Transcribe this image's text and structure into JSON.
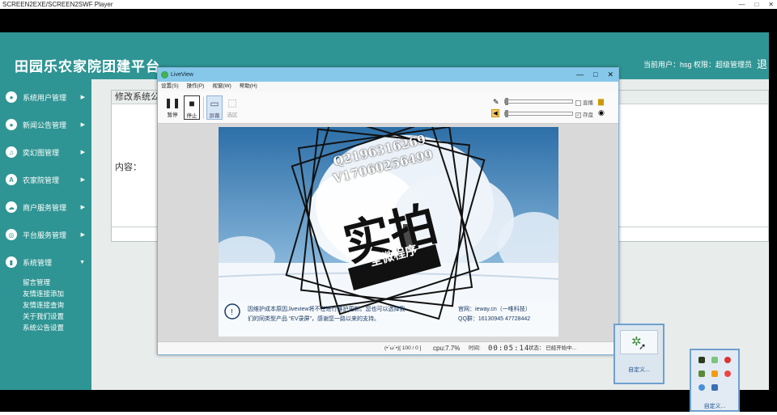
{
  "player": {
    "title": "SCREEN2EXE/SCREEN2SWF Player",
    "controls": [
      "—",
      "□",
      "✕"
    ]
  },
  "app": {
    "title": "田园乐农家院团建平台",
    "user_info": "当前用户：hsg  权限：超级管理员",
    "logout": "退",
    "accent_color": "#2f9594"
  },
  "sidebar": {
    "items": [
      {
        "label": "系统用户管理",
        "icon": "user-icon"
      },
      {
        "label": "新闻公告管理",
        "icon": "people-icon"
      },
      {
        "label": "奕幻图管理",
        "icon": "music-icon"
      },
      {
        "label": "农家院管理",
        "icon": "app-icon"
      },
      {
        "label": "商户服务管理",
        "icon": "cloud-icon"
      },
      {
        "label": "平台服务管理",
        "icon": "target-icon"
      },
      {
        "label": "系统管理",
        "icon": "chart-icon"
      }
    ],
    "sub_items": [
      "留言管理",
      "友情连接添加",
      "友情连接查询",
      "关于我们设置",
      "系统公告设置"
    ]
  },
  "content": {
    "panel_title": "修改系统公",
    "field_label": "内容："
  },
  "liveview": {
    "title": "LiveView",
    "menu": [
      "设置(S)",
      "操作(P)",
      "视窗(W)",
      "帮助(H)"
    ],
    "toolbar": {
      "pause": "暂停",
      "stop": "停止",
      "screen": "屏幕",
      "select": "选区"
    },
    "checks": {
      "direct": "直播",
      "save": "存盘"
    },
    "watermark": {
      "line1": "Q2196316269",
      "line2": "V17060256499",
      "main": "实拍",
      "sub": "全微程序"
    },
    "notice": {
      "text1": "因维护成本原因,liveview将不在进行维护更新。您也可以选择我",
      "text2": "们的同类型产品 “EV录屏”，感谢您一路以来的支持。",
      "site": "官网：ieway.cn（一唯科技）",
      "qq": "QQ群：16130945  47728442"
    },
    "status": {
      "face": "(•`ω´•)[ 100 / 0 ]",
      "cpu": "cpu:7.7%",
      "time_label": "时间:",
      "time": "00:05:14",
      "state": "状态：  已经开始中..."
    }
  },
  "tray": {
    "popup1_label": "自定义...",
    "popup2_label": "自定义..."
  }
}
